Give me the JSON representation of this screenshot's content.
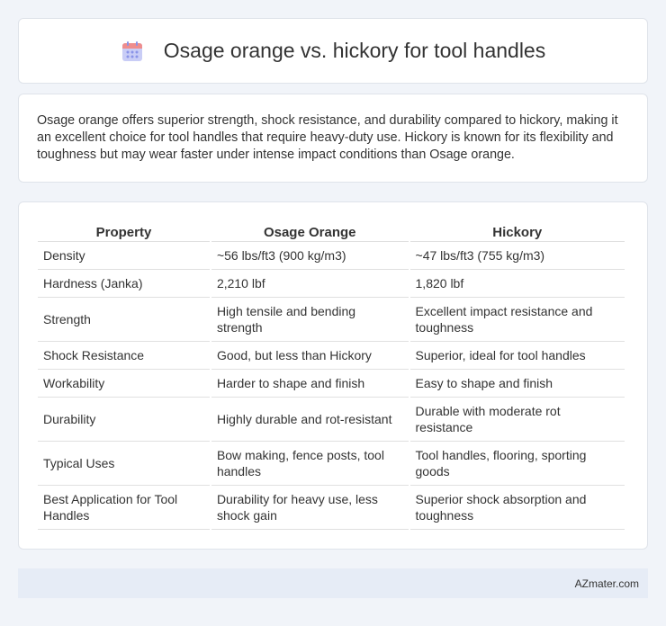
{
  "header": {
    "title": "Osage orange vs. hickory for tool handles",
    "icon": "calendar-icon",
    "icon_colors": {
      "top": "#ef8d8d",
      "body": "#c9cdf6",
      "dots": "#8a94e8"
    }
  },
  "summary": {
    "text": "Osage orange offers superior strength, shock resistance, and durability compared to hickory, making it an excellent choice for tool handles that require heavy-duty use. Hickory is known for its flexibility and toughness but may wear faster under intense impact conditions than Osage orange."
  },
  "table": {
    "headers": [
      "Property",
      "Osage Orange",
      "Hickory"
    ],
    "rows": [
      [
        "Density",
        "~56 lbs/ft3 (900 kg/m3)",
        "~47 lbs/ft3 (755 kg/m3)"
      ],
      [
        "Hardness (Janka)",
        "2,210 lbf",
        "1,820 lbf"
      ],
      [
        "Strength",
        "High tensile and bending strength",
        "Excellent impact resistance and toughness"
      ],
      [
        "Shock Resistance",
        "Good, but less than Hickory",
        "Superior, ideal for tool handles"
      ],
      [
        "Workability",
        "Harder to shape and finish",
        "Easy to shape and finish"
      ],
      [
        "Durability",
        "Highly durable and rot-resistant",
        "Durable with moderate rot resistance"
      ],
      [
        "Typical Uses",
        "Bow making, fence posts, tool handles",
        "Tool handles, flooring, sporting goods"
      ],
      [
        "Best Application for Tool Handles",
        "Durability for heavy use, less shock gain",
        "Superior shock absorption and toughness"
      ]
    ]
  },
  "footer": {
    "text": "AZmater.com"
  }
}
